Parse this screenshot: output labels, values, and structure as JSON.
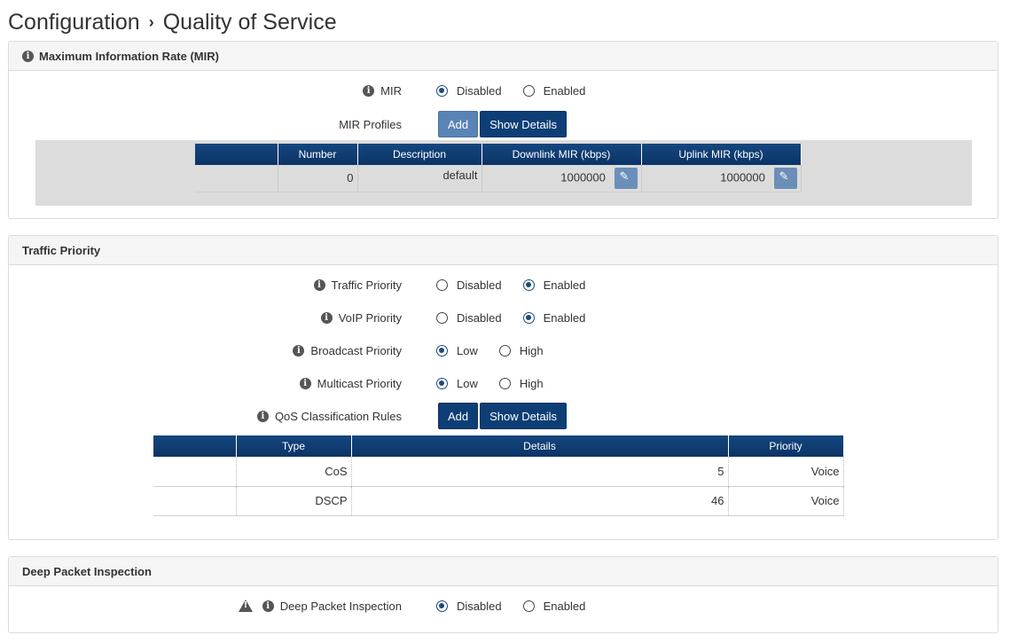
{
  "breadcrumb": {
    "parent": "Configuration",
    "separator": "›",
    "current": "Quality of Service"
  },
  "mir_panel": {
    "title": "Maximum Information Rate (MIR)",
    "mir_label": "MIR",
    "mir_options": [
      "Disabled",
      "Enabled"
    ],
    "mir_selected": "Disabled",
    "profiles_label": "MIR Profiles",
    "add_label": "Add",
    "show_details_label": "Show Details",
    "table": {
      "headers": [
        "Number",
        "Description",
        "Downlink MIR (kbps)",
        "Uplink MIR (kbps)"
      ],
      "rows": [
        {
          "number": "0",
          "description": "default",
          "downlink": "1000000",
          "uplink": "1000000"
        }
      ]
    }
  },
  "traffic_panel": {
    "title": "Traffic Priority",
    "traffic_priority": {
      "label": "Traffic Priority",
      "options": [
        "Disabled",
        "Enabled"
      ],
      "selected": "Enabled"
    },
    "voip_priority": {
      "label": "VoIP Priority",
      "options": [
        "Disabled",
        "Enabled"
      ],
      "selected": "Enabled"
    },
    "broadcast_priority": {
      "label": "Broadcast Priority",
      "options": [
        "Low",
        "High"
      ],
      "selected": "Low"
    },
    "multicast_priority": {
      "label": "Multicast Priority",
      "options": [
        "Low",
        "High"
      ],
      "selected": "Low"
    },
    "qos_rules_label": "QoS Classification Rules",
    "add_label": "Add",
    "show_details_label": "Show Details",
    "table": {
      "headers": [
        "Type",
        "Details",
        "Priority"
      ],
      "rows": [
        {
          "type": "CoS",
          "details": "5",
          "priority": "Voice"
        },
        {
          "type": "DSCP",
          "details": "46",
          "priority": "Voice"
        }
      ]
    }
  },
  "dpi_panel": {
    "title": "Deep Packet Inspection",
    "label": "Deep Packet Inspection",
    "options": [
      "Disabled",
      "Enabled"
    ],
    "selected": "Disabled"
  }
}
